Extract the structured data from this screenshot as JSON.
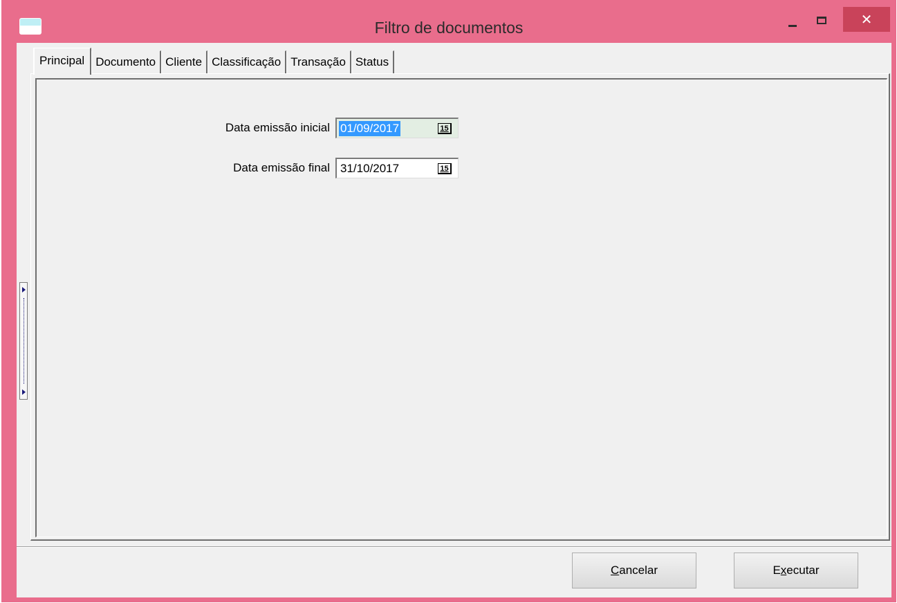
{
  "window": {
    "title": "Filtro de documentos",
    "accent_color": "#e96d8c",
    "close_color": "#c9435a",
    "close_glyph": "✕"
  },
  "tabs": [
    {
      "label": "Principal",
      "active": true
    },
    {
      "label": "Documento",
      "active": false
    },
    {
      "label": "Cliente",
      "active": false
    },
    {
      "label": "Classificação",
      "active": false
    },
    {
      "label": "Transação",
      "active": false
    },
    {
      "label": "Status",
      "active": false
    }
  ],
  "fields": {
    "start_date": {
      "label": "Data emissão inicial",
      "value": "01/09/2017"
    },
    "end_date": {
      "label": "Data emissão final",
      "value": "31/10/2017"
    },
    "calendar_icon_text": "15"
  },
  "actions": {
    "cancel": {
      "mnemonic": "C",
      "rest": "ancelar"
    },
    "execute": {
      "pre": "E",
      "mnemonic": "x",
      "rest": "ecutar"
    }
  }
}
